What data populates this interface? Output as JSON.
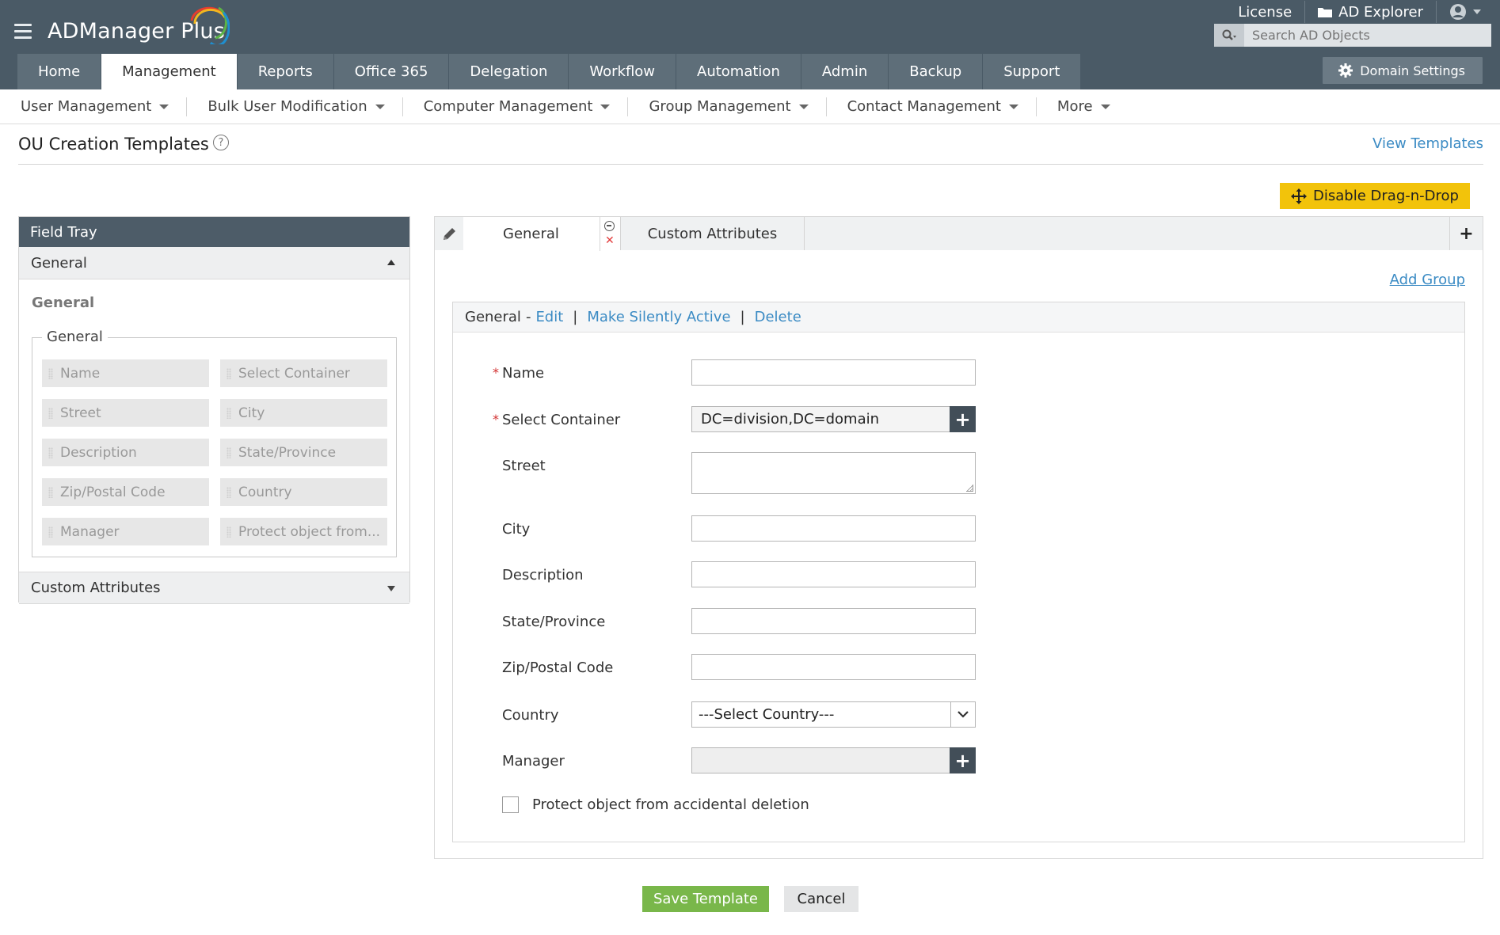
{
  "app": {
    "name": "ADManager Plus",
    "brand_colors": [
      "#e63c2f",
      "#f2b61f",
      "#5cb546",
      "#1f8fd0"
    ]
  },
  "top_links": {
    "license": "License",
    "ad_explorer": "AD Explorer",
    "user_icon": "user-circle-icon"
  },
  "search": {
    "placeholder": "Search AD Objects"
  },
  "nav": {
    "tabs": [
      {
        "label": "Home"
      },
      {
        "label": "Management",
        "active": true
      },
      {
        "label": "Reports"
      },
      {
        "label": "Office 365"
      },
      {
        "label": "Delegation"
      },
      {
        "label": "Workflow"
      },
      {
        "label": "Automation"
      },
      {
        "label": "Admin"
      },
      {
        "label": "Backup"
      },
      {
        "label": "Support"
      }
    ],
    "domain_settings": "Domain Settings"
  },
  "subnav": {
    "items": [
      {
        "label": "User Management"
      },
      {
        "label": "Bulk User Modification"
      },
      {
        "label": "Computer Management"
      },
      {
        "label": "Group Management"
      },
      {
        "label": "Contact Management"
      },
      {
        "label": "More"
      }
    ]
  },
  "page": {
    "title": "OU Creation Templates",
    "help": "?",
    "view_templates": "View Templates",
    "drag_drop_button": "Disable Drag-n-Drop"
  },
  "field_tray": {
    "header": "Field Tray",
    "section_general": "General",
    "group_title": "General",
    "fieldset_legend": "General",
    "fields": [
      "Name",
      "Select Container",
      "Street",
      "City",
      "Description",
      "State/Province",
      "Zip/Postal Code",
      "Country",
      "Manager",
      "Protect object from..."
    ],
    "section_custom": "Custom Attributes"
  },
  "editor": {
    "tabs": {
      "general": "General",
      "custom": "Custom Attributes",
      "add": "+"
    },
    "add_group": "Add Group",
    "group": {
      "name": "General",
      "dash": "-",
      "edit": "Edit",
      "sep": "|",
      "make_silently_active": "Make Silently Active",
      "delete": "Delete"
    },
    "required_mark": "*",
    "fields": {
      "name": {
        "label": "Name",
        "value": ""
      },
      "container": {
        "label": "Select Container",
        "value": "DC=division,DC=domain"
      },
      "street": {
        "label": "Street",
        "value": ""
      },
      "city": {
        "label": "City",
        "value": ""
      },
      "description": {
        "label": "Description",
        "value": ""
      },
      "state": {
        "label": "State/Province",
        "value": ""
      },
      "zip": {
        "label": "Zip/Postal Code",
        "value": ""
      },
      "country": {
        "label": "Country",
        "value": "---Select Country---"
      },
      "manager": {
        "label": "Manager",
        "value": ""
      },
      "protect": {
        "label": "Protect object from accidental deletion",
        "checked": false
      }
    }
  },
  "actions": {
    "save": "Save Template",
    "cancel": "Cancel"
  }
}
